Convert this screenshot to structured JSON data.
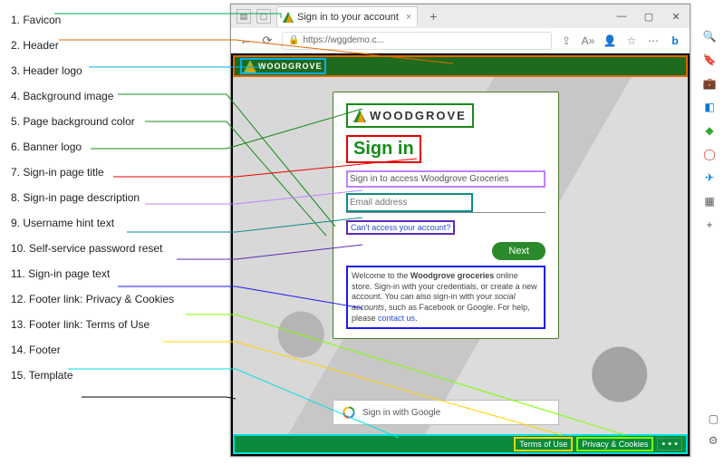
{
  "annotations": [
    "1. Favicon",
    "2. Header",
    "3. Header logo",
    "4. Background image",
    "5. Page background color",
    "6. Banner logo",
    "7. Sign-in page title",
    "8. Sign-in page description",
    "9. Username hint text",
    "10. Self-service password reset",
    "11. Sign-in page text",
    "12. Footer link: Privacy & Cookies",
    "13. Footer link: Terms of Use",
    "14. Footer",
    "15. Template"
  ],
  "tab": {
    "title": "Sign in to your account"
  },
  "addr": {
    "url": "https://wggdemo.c..."
  },
  "brand": {
    "name": "WOODGROVE"
  },
  "signin": {
    "title": "Sign in",
    "desc": "Sign in to access Woodgrove Groceries",
    "placeholder": "Email address",
    "forgot": "Can't access your account?",
    "next": "Next",
    "text1": "Welcome to the ",
    "text1b": "Woodgrove groceries",
    "text2": " online store. Sign-in with your credentials, or create a new account. You can also sign-in with your ",
    "text2i": "social accounts",
    "text3": ", such as Facebook or Google. For help, please ",
    "contact": "contact us",
    "text4": "."
  },
  "google": {
    "label": "Sign in with Google"
  },
  "footer": {
    "terms": "Terms of Use",
    "privacy": "Privacy & Cookies",
    "more": "• • •"
  }
}
